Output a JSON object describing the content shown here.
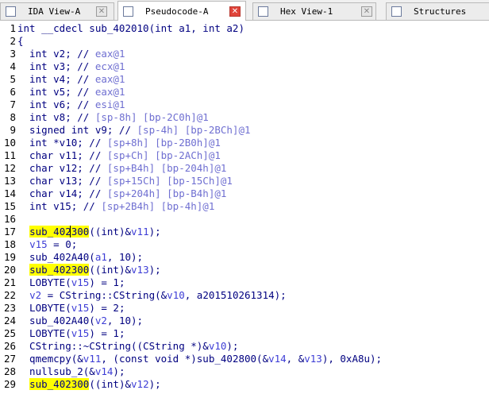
{
  "tabs": [
    {
      "label": "IDA View-A",
      "active": false,
      "icon": "ida-view-icon"
    },
    {
      "label": "Pseudocode-A",
      "active": true,
      "icon": "pseudocode-icon"
    },
    {
      "label": "Hex View-1",
      "active": false,
      "icon": "hex-view-icon"
    },
    {
      "label": "Structures",
      "active": false,
      "icon": "structures-icon"
    }
  ],
  "close_glyph": "✕",
  "colors": {
    "keyword": "#000080",
    "comment": "#6f6fd1",
    "variable": "#3d3dd6",
    "highlight": "#ffff00",
    "active_close": "#e0443a"
  },
  "code_lines": [
    {
      "n": "1",
      "tokens": [
        [
          "int __cdecl sub_402010(int a1, int a2)",
          ""
        ]
      ]
    },
    {
      "n": "2",
      "tokens": [
        [
          "{",
          ""
        ]
      ]
    },
    {
      "n": "3",
      "tokens": [
        [
          "  int v2; // ",
          ""
        ],
        [
          "eax@1",
          "c"
        ]
      ]
    },
    {
      "n": "4",
      "tokens": [
        [
          "  int v3; // ",
          ""
        ],
        [
          "ecx@1",
          "c"
        ]
      ]
    },
    {
      "n": "5",
      "tokens": [
        [
          "  int v4; // ",
          ""
        ],
        [
          "eax@1",
          "c"
        ]
      ]
    },
    {
      "n": "6",
      "tokens": [
        [
          "  int v5; // ",
          ""
        ],
        [
          "eax@1",
          "c"
        ]
      ]
    },
    {
      "n": "7",
      "tokens": [
        [
          "  int v6; // ",
          ""
        ],
        [
          "esi@1",
          "c"
        ]
      ]
    },
    {
      "n": "8",
      "tokens": [
        [
          "  int v8; // ",
          ""
        ],
        [
          "[sp-8h] [bp-2C0h]@1",
          "c"
        ]
      ]
    },
    {
      "n": "9",
      "tokens": [
        [
          "  signed int v9; // ",
          ""
        ],
        [
          "[sp-4h] [bp-2BCh]@1",
          "c"
        ]
      ]
    },
    {
      "n": "10",
      "tokens": [
        [
          "  int *v10; // ",
          ""
        ],
        [
          "[sp+8h] [bp-2B0h]@1",
          "c"
        ]
      ]
    },
    {
      "n": "11",
      "tokens": [
        [
          "  char v11; // ",
          ""
        ],
        [
          "[sp+Ch] [bp-2ACh]@1",
          "c"
        ]
      ]
    },
    {
      "n": "12",
      "tokens": [
        [
          "  char v12; // ",
          ""
        ],
        [
          "[sp+B4h] [bp-204h]@1",
          "c"
        ]
      ]
    },
    {
      "n": "13",
      "tokens": [
        [
          "  char v13; // ",
          ""
        ],
        [
          "[sp+15Ch] [bp-15Ch]@1",
          "c"
        ]
      ]
    },
    {
      "n": "14",
      "tokens": [
        [
          "  char v14; // ",
          ""
        ],
        [
          "[sp+204h] [bp-B4h]@1",
          "c"
        ]
      ]
    },
    {
      "n": "15",
      "tokens": [
        [
          "  int v15; // ",
          ""
        ],
        [
          "[sp+2B4h] [bp-4h]@1",
          "c"
        ]
      ]
    },
    {
      "n": "16",
      "tokens": [
        [
          "",
          ""
        ]
      ]
    },
    {
      "n": "17",
      "tokens": [
        [
          "  ",
          ""
        ],
        [
          "sub_402300",
          "h"
        ],
        [
          "((int)&",
          ""
        ],
        [
          "v11",
          "v"
        ],
        [
          ");",
          ""
        ]
      ]
    },
    {
      "n": "18",
      "tokens": [
        [
          "  ",
          ""
        ],
        [
          "v15",
          "v"
        ],
        [
          " = 0;",
          ""
        ]
      ]
    },
    {
      "n": "19",
      "tokens": [
        [
          "  sub_402A40(",
          ""
        ],
        [
          "a1",
          "v"
        ],
        [
          ", 10);",
          ""
        ]
      ]
    },
    {
      "n": "20",
      "tokens": [
        [
          "  ",
          ""
        ],
        [
          "sub_402300",
          "h"
        ],
        [
          "((int)&",
          ""
        ],
        [
          "v13",
          "v"
        ],
        [
          ");",
          ""
        ]
      ]
    },
    {
      "n": "21",
      "tokens": [
        [
          "  LOBYTE(",
          ""
        ],
        [
          "v15",
          "v"
        ],
        [
          ") = 1;",
          ""
        ]
      ]
    },
    {
      "n": "22",
      "tokens": [
        [
          "  ",
          ""
        ],
        [
          "v2",
          "v"
        ],
        [
          " = CString::CString(&",
          ""
        ],
        [
          "v10",
          "v"
        ],
        [
          ", a201510261314);",
          ""
        ]
      ]
    },
    {
      "n": "23",
      "tokens": [
        [
          "  LOBYTE(",
          ""
        ],
        [
          "v15",
          "v"
        ],
        [
          ") = 2;",
          ""
        ]
      ]
    },
    {
      "n": "24",
      "tokens": [
        [
          "  sub_402A40(",
          ""
        ],
        [
          "v2",
          "v"
        ],
        [
          ", 10);",
          ""
        ]
      ]
    },
    {
      "n": "25",
      "tokens": [
        [
          "  LOBYTE(",
          ""
        ],
        [
          "v15",
          "v"
        ],
        [
          ") = 1;",
          ""
        ]
      ]
    },
    {
      "n": "26",
      "tokens": [
        [
          "  CString::~CString((CString *)&",
          ""
        ],
        [
          "v10",
          "v"
        ],
        [
          ");",
          ""
        ]
      ]
    },
    {
      "n": "27",
      "tokens": [
        [
          "  qmemcpy(&",
          ""
        ],
        [
          "v11",
          "v"
        ],
        [
          ", (const void *)sub_402800(&",
          ""
        ],
        [
          "v14",
          "v"
        ],
        [
          ", &",
          ""
        ],
        [
          "v13",
          "v"
        ],
        [
          "), 0xA8u);",
          ""
        ]
      ]
    },
    {
      "n": "28",
      "tokens": [
        [
          "  nullsub_2(&",
          ""
        ],
        [
          "v14",
          "v"
        ],
        [
          ");",
          ""
        ]
      ]
    },
    {
      "n": "29",
      "tokens": [
        [
          "  ",
          ""
        ],
        [
          "sub_402300",
          "h"
        ],
        [
          "((int)&",
          ""
        ],
        [
          "v12",
          "v"
        ],
        [
          ");",
          ""
        ]
      ]
    }
  ]
}
